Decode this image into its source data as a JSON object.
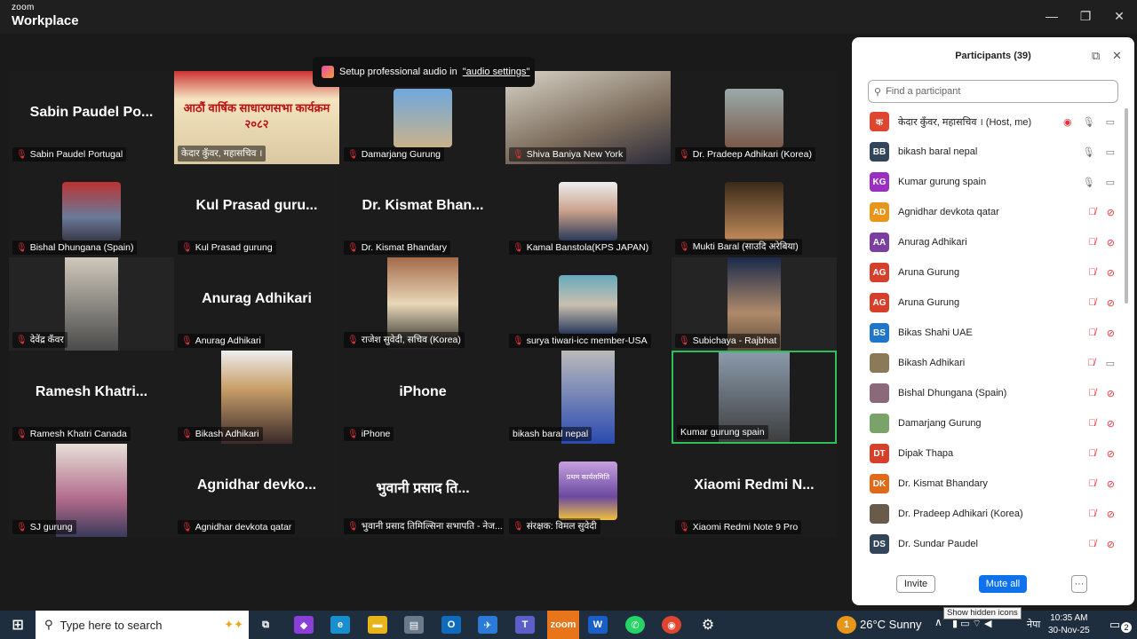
{
  "window": {
    "brand_top": "zoom",
    "brand_name": "Workplace",
    "minimize": "—",
    "maximize": "❐",
    "close": "✕"
  },
  "toast": {
    "text": "Setup professional audio in",
    "link": "\"audio settings\""
  },
  "tiles": [
    {
      "name": "Sabin Paudel Po...",
      "label": "Sabin Paudel Portugal",
      "muted": true
    },
    {
      "name": "",
      "label": "केदार कुँवर, महासचिव ।",
      "muted": false,
      "banner": "आठौं वार्षिक साधारणसभा कार्यक्रम",
      "banner_year": "२०८२"
    },
    {
      "name": "",
      "label": "Damarjang Gurung",
      "muted": true
    },
    {
      "name": "",
      "label": "Shiva Baniya New York",
      "muted": true
    },
    {
      "name": "",
      "label": "Dr. Pradeep Adhikari (Korea)",
      "muted": true
    },
    {
      "name": "",
      "label": "Bishal Dhungana (Spain)",
      "muted": true
    },
    {
      "name": "Kul Prasad guru...",
      "label": "Kul Prasad gurung",
      "muted": true
    },
    {
      "name": "Dr. Kismat Bhan...",
      "label": "Dr. Kismat Bhandary",
      "muted": true
    },
    {
      "name": "",
      "label": "Kamal Banstola(KPS JAPAN)",
      "muted": true
    },
    {
      "name": "",
      "label": "Mukti Baral (साउदि अरेबिया)",
      "muted": true
    },
    {
      "name": "",
      "label": "देवेंद्र कँवर",
      "muted": true
    },
    {
      "name": "Anurag Adhikari",
      "label": "Anurag Adhikari",
      "muted": true
    },
    {
      "name": "",
      "label": "राजेश सुवेदी, सचिव (Korea)",
      "muted": true
    },
    {
      "name": "",
      "label": "surya tiwari-icc member-USA",
      "muted": true
    },
    {
      "name": "",
      "label": "Subichaya - Rajbhat",
      "muted": true
    },
    {
      "name": "Ramesh Khatri...",
      "label": "Ramesh Khatri Canada",
      "muted": true
    },
    {
      "name": "",
      "label": "Bikash Adhikari",
      "muted": true
    },
    {
      "name": "iPhone",
      "label": "iPhone",
      "muted": true
    },
    {
      "name": "",
      "label": "bikash baral nepal",
      "muted": false
    },
    {
      "name": "",
      "label": "Kumar gurung  spain",
      "muted": false
    },
    {
      "name": "",
      "label": "SJ gurung",
      "muted": true
    },
    {
      "name": "Agnidhar devko...",
      "label": "Agnidhar devkota qatar",
      "muted": true
    },
    {
      "name": "भुवानी प्रसाद ति...",
      "label": "भुवानी प्रसाद तिमिल्सिना सभापति - नेज...",
      "muted": true
    },
    {
      "name": "",
      "label": "संरक्षक: विमल सुवेदी",
      "muted": true,
      "poster": "प्रथम कार्यसमिति"
    },
    {
      "name": "Xiaomi Redmi N...",
      "label": "Xiaomi Redmi Note 9 Pro",
      "muted": true
    }
  ],
  "panel": {
    "title": "Participants (39)",
    "search_placeholder": "Find a participant",
    "participants": [
      {
        "initials": "क",
        "color": "#e0452f",
        "name": "केदार कुँवर, महासचिव । (Host, me)",
        "mic": "on",
        "video": "off"
      },
      {
        "initials": "BB",
        "color": "#33455a",
        "name": "bikash baral nepal",
        "mic": "on",
        "video": "off"
      },
      {
        "initials": "KG",
        "color": "#9b2fbf",
        "name": "Kumar gurung  spain",
        "mic": "on",
        "video": "off"
      },
      {
        "initials": "AD",
        "color": "#e8951a",
        "name": "Agnidhar devkota qatar",
        "mic": "muted",
        "video": "muted"
      },
      {
        "initials": "AA",
        "color": "#7b3fa0",
        "name": "Anurag Adhikari",
        "mic": "muted",
        "video": "muted"
      },
      {
        "initials": "AG",
        "color": "#d6402a",
        "name": "Aruna Gurung",
        "mic": "muted",
        "video": "muted"
      },
      {
        "initials": "AG",
        "color": "#d6402a",
        "name": "Aruna Gurung",
        "mic": "muted",
        "video": "muted"
      },
      {
        "initials": "BS",
        "color": "#1f76c8",
        "name": "Bikas Shahi UAE",
        "mic": "muted",
        "video": "muted"
      },
      {
        "initials": "",
        "color": "#8a7a5a",
        "name": "Bikash Adhikari",
        "mic": "muted",
        "video": "off"
      },
      {
        "initials": "",
        "color": "#8a6a7a",
        "name": "Bishal Dhungana (Spain)",
        "mic": "muted",
        "video": "muted"
      },
      {
        "initials": "",
        "color": "#7aa36a",
        "name": "Damarjang Gurung",
        "mic": "muted",
        "video": "muted"
      },
      {
        "initials": "DT",
        "color": "#d6402a",
        "name": "Dipak Thapa",
        "mic": "muted",
        "video": "muted"
      },
      {
        "initials": "DK",
        "color": "#e06a1a",
        "name": "Dr. Kismat Bhandary",
        "mic": "muted",
        "video": "muted"
      },
      {
        "initials": "",
        "color": "#6a5a4a",
        "name": "Dr. Pradeep Adhikari (Korea)",
        "mic": "muted",
        "video": "muted"
      },
      {
        "initials": "DS",
        "color": "#33455a",
        "name": "Dr. Sundar Paudel",
        "mic": "muted",
        "video": "muted"
      }
    ],
    "invite": "Invite",
    "mute_all": "Mute all",
    "more": "···"
  },
  "tooltip": "Show hidden icons",
  "taskbar": {
    "search_placeholder": "Type here to search",
    "weather": "26°C  Sunny",
    "lang": "नेपा",
    "time": "10:35 AM",
    "date": "30-Nov-25",
    "notification_count": "1",
    "notifications_badge": "2"
  }
}
